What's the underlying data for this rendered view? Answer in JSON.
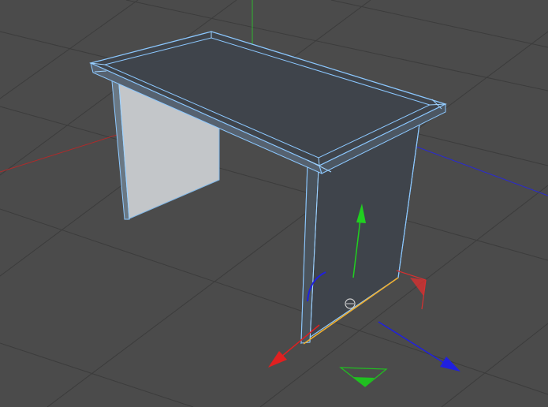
{
  "viewport": {
    "type": "3d-perspective-view",
    "background_color": "#4b4b4b",
    "grid_color": "#3d3d3d",
    "world_axis_colors": {
      "x": "#b02a2a",
      "y": "#2fb52f",
      "z": "#2a2ad0"
    }
  },
  "object": {
    "name": "table",
    "body_color": "#3f444b",
    "wireframe_highlight_color": "#8cc8ff",
    "side_panel_color": "#c2c5c8",
    "selected_edge_color": "#f0b030"
  },
  "gizmo": {
    "type": "move-tool",
    "x_axis_color": "#e02020",
    "y_axis_color": "#20d020",
    "z_axis_color": "#2020e0",
    "rotation_handle_color": "#d83030"
  }
}
